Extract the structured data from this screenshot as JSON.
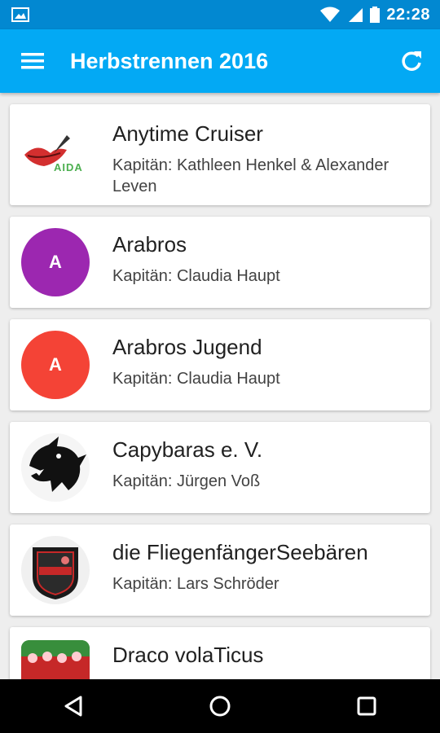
{
  "status_bar": {
    "time": "22:28"
  },
  "app_bar": {
    "title": "Herbstrennen 2016"
  },
  "teams": [
    {
      "name": "Anytime Cruiser",
      "captain": "Kapitän: Kathleen Henkel & Alexander Leven",
      "logo_text": "AIDA"
    },
    {
      "name": "Arabros",
      "captain": "Kapitän: Claudia Haupt",
      "avatar_letter": "A",
      "avatar_color": "#9c27b0"
    },
    {
      "name": "Arabros Jugend",
      "captain": "Kapitän: Claudia Haupt",
      "avatar_letter": "A",
      "avatar_color": "#f44336"
    },
    {
      "name": "Capybaras e. V.",
      "captain": "Kapitän: Jürgen Voß"
    },
    {
      "name": "die FliegenfängerSeebären",
      "captain": "Kapitän: Lars Schröder"
    },
    {
      "name": "Draco volaTicus",
      "captain": ""
    }
  ],
  "colors": {
    "status_bar": "#0288d1",
    "app_bar": "#03a9f4",
    "background": "#eeeeee",
    "nav_bar": "#000000"
  }
}
